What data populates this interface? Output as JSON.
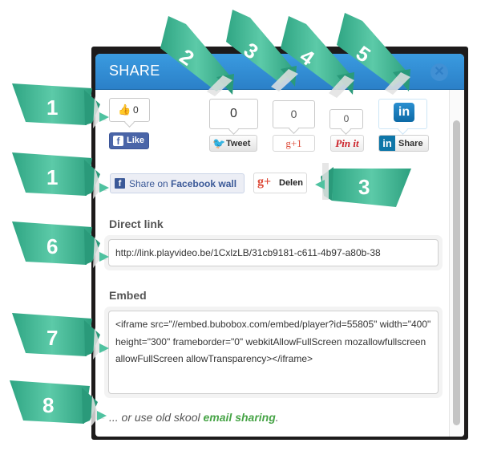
{
  "dialog": {
    "title": "SHARE",
    "close_icon": "close-icon"
  },
  "social_row": {
    "facebook": {
      "count": "0",
      "button_label": "Like",
      "icon": "thumbs-up-icon"
    },
    "twitter": {
      "count": "0",
      "button_label": "Tweet",
      "icon": "twitter-bird-icon"
    },
    "google_plus": {
      "count": "0",
      "button_label": "g+1"
    },
    "pinterest": {
      "count": "0",
      "button_label": "Pin it"
    },
    "linkedin": {
      "logo": "in",
      "button_label": "Share",
      "icon": "linkedin-icon"
    }
  },
  "second_row": {
    "facebook_wall": {
      "prefix": "Share on ",
      "bold": "Facebook wall"
    },
    "google_delen": {
      "icon": "g+",
      "label": "Delen"
    }
  },
  "direct_link": {
    "label": "Direct link",
    "value": "http://link.playvideo.be/1CxlzLB/31cb9181-c611-4b97-a80b-38"
  },
  "embed": {
    "label": "Embed",
    "value": "<iframe src=\"//embed.bubobox.com/embed/player?id=55805\" width=\"400\" height=\"300\" frameborder=\"0\" webkitAllowFullScreen mozallowfullscreen allowFullScreen allowTransparency></iframe>"
  },
  "footer": {
    "prefix": "... or use old skool ",
    "link": "email sharing",
    "suffix": "."
  },
  "callouts": [
    "1",
    "1",
    "2",
    "3",
    "3",
    "4",
    "5",
    "6",
    "7",
    "8"
  ],
  "colors": {
    "header_blue": "#2b80c8",
    "ribbon_teal": "#3dbb96",
    "link_green": "#47a447",
    "facebook_blue": "#3b5998"
  }
}
